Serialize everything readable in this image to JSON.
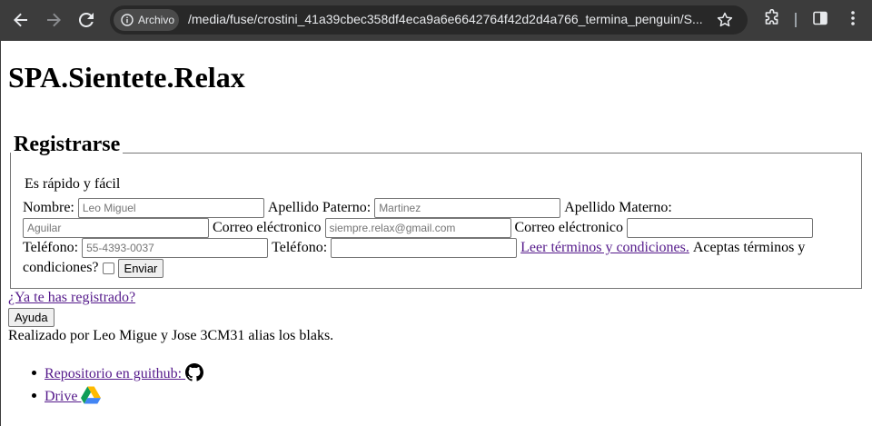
{
  "browser": {
    "chip_label": "Archivo",
    "url": "/media/fuse/crostini_41a39cbec358df4eca9a6e6642764f42d2d4a766_termina_penguin/S..."
  },
  "page": {
    "title": "SPA.Sientete.Relax",
    "form": {
      "legend": "Registrarse",
      "intro": "Es rápido y fácil",
      "nombre_label": "Nombre:",
      "nombre_placeholder": "Leo Miguel",
      "paterno_label": "Apellido Paterno:",
      "paterno_placeholder": "Martinez",
      "materno_label": "Apellido Materno:",
      "materno_placeholder": "Aguilar",
      "correo_label": "Correo eléctronico",
      "correo_placeholder": "siempre.relax@gmail.com",
      "correo2_label": "Correo eléctronico",
      "telefono_label": "Teléfono:",
      "telefono_placeholder": "55-4393-0037",
      "telefono2_label": "Teléfono:",
      "terms_link": "Leer términos y condiciones.",
      "accept_label_1": "Aceptas términos y",
      "accept_label_2": "condiciones?",
      "submit_label": "Enviar"
    },
    "registered_link": "¿Ya te has registrado?",
    "help_button": "Ayuda",
    "credits": "Realizado por Leo Migue y Jose 3CM31 alias los blaks.",
    "links": [
      {
        "label": "Repositorio en guithub: ",
        "icon": "github-icon"
      },
      {
        "label": "Drive ",
        "icon": "google-drive-icon"
      }
    ]
  },
  "colors": {
    "chrome_bg": "#3c3c3c",
    "omnibox_bg": "#282828",
    "link_visited": "#551a8b"
  }
}
